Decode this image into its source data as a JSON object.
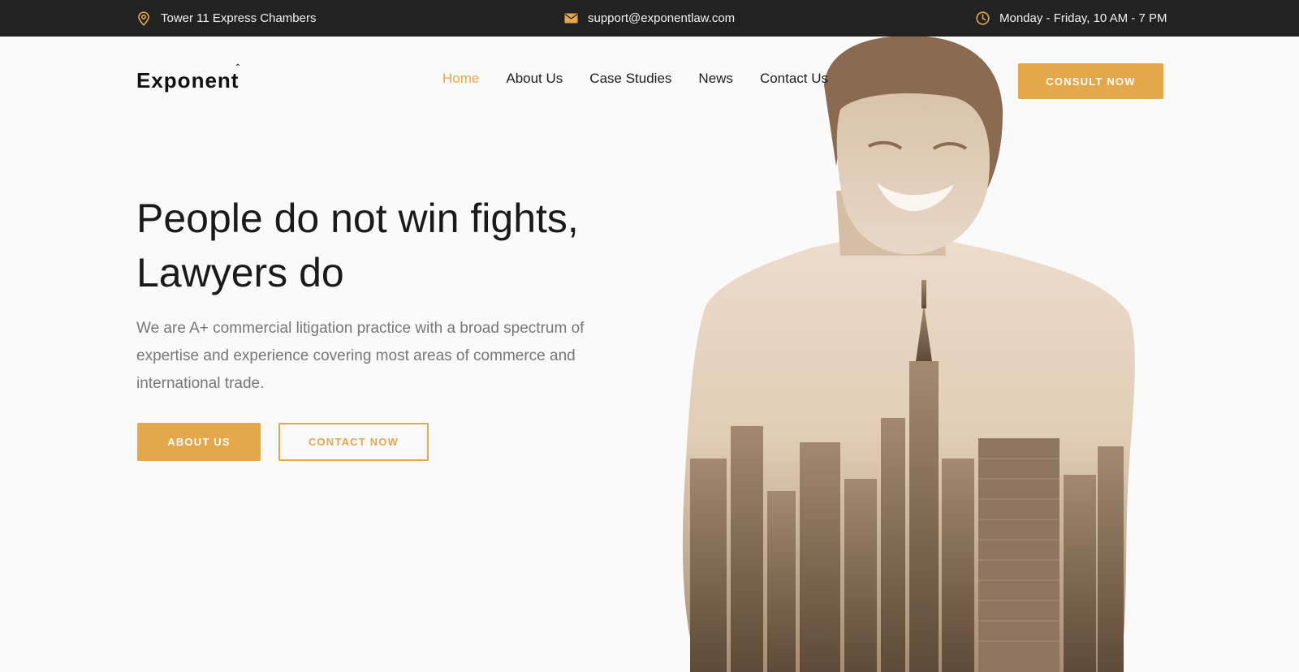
{
  "topbar": {
    "address": "Tower 11 Express Chambers",
    "email": "support@exponentlaw.com",
    "hours": "Monday - Friday, 10 AM - 7 PM",
    "icons": {
      "address": "map-pin-icon",
      "email": "envelope-icon",
      "hours": "clock-icon"
    }
  },
  "header": {
    "logo": "Exponent",
    "nav": [
      {
        "label": "Home",
        "active": true
      },
      {
        "label": "About Us",
        "active": false
      },
      {
        "label": "Case Studies",
        "active": false
      },
      {
        "label": "News",
        "active": false
      },
      {
        "label": "Contact Us",
        "active": false
      }
    ],
    "cta": "CONSULT NOW"
  },
  "hero": {
    "headline_line1": "People do not win fights,",
    "headline_line2": "Lawyers do",
    "subtext": "We are A+ commercial litigation practice with a broad spectrum of expertise and experience covering most areas of commerce and international trade.",
    "primary_button": "ABOUT US",
    "secondary_button": "CONTACT NOW"
  },
  "colors": {
    "accent": "#e4a84b",
    "topbar_bg": "#222222",
    "page_bg": "#fafafa",
    "text_dark": "#1a1a1a",
    "text_muted": "#777777"
  }
}
